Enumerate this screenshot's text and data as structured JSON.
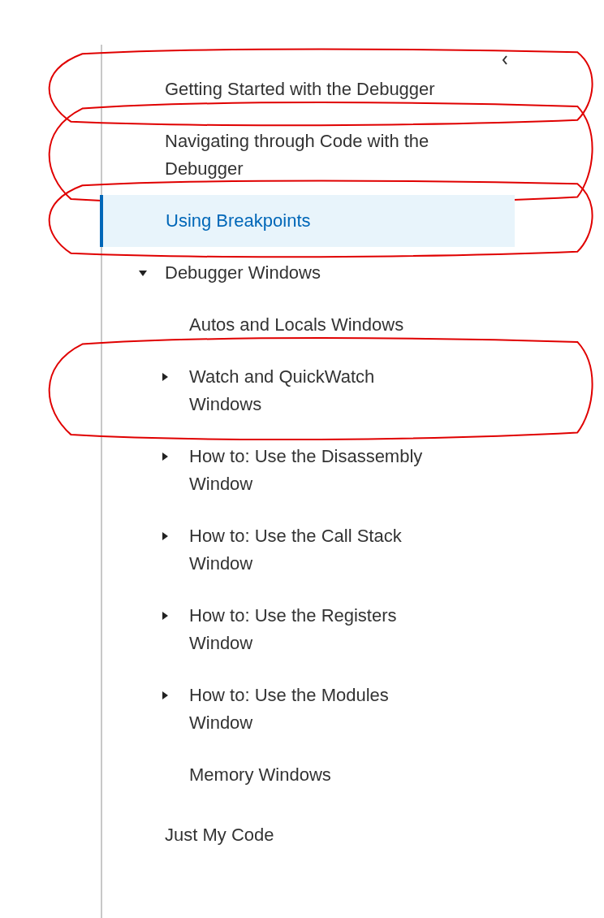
{
  "sidebar": {
    "collapse_button": true,
    "items": [
      {
        "label": "Getting Started with the Debugger",
        "selected": false,
        "circled": true
      },
      {
        "label": "Navigating through Code with the Debugger",
        "selected": false,
        "circled": true
      },
      {
        "label": "Using Breakpoints",
        "selected": true,
        "circled": true
      },
      {
        "label": "Debugger Windows",
        "selected": false,
        "circled": false,
        "expanded": true,
        "children": [
          {
            "label": "Autos and Locals Windows",
            "selected": false,
            "circled": false
          },
          {
            "label": "Watch and QuickWatch Windows",
            "selected": false,
            "circled": true,
            "expanded": false
          },
          {
            "label": "How to: Use the Disassembly Window",
            "selected": false,
            "circled": false,
            "expanded": false
          },
          {
            "label": "How to: Use the Call Stack Window",
            "selected": false,
            "circled": false,
            "expanded": false
          },
          {
            "label": "How to: Use the Registers Window",
            "selected": false,
            "circled": false,
            "expanded": false
          },
          {
            "label": "How to: Use the Modules Window",
            "selected": false,
            "circled": false,
            "expanded": false
          },
          {
            "label": "Memory Windows",
            "selected": false,
            "circled": false
          }
        ]
      },
      {
        "label": "Just My Code",
        "selected": false,
        "circled": false
      }
    ]
  }
}
